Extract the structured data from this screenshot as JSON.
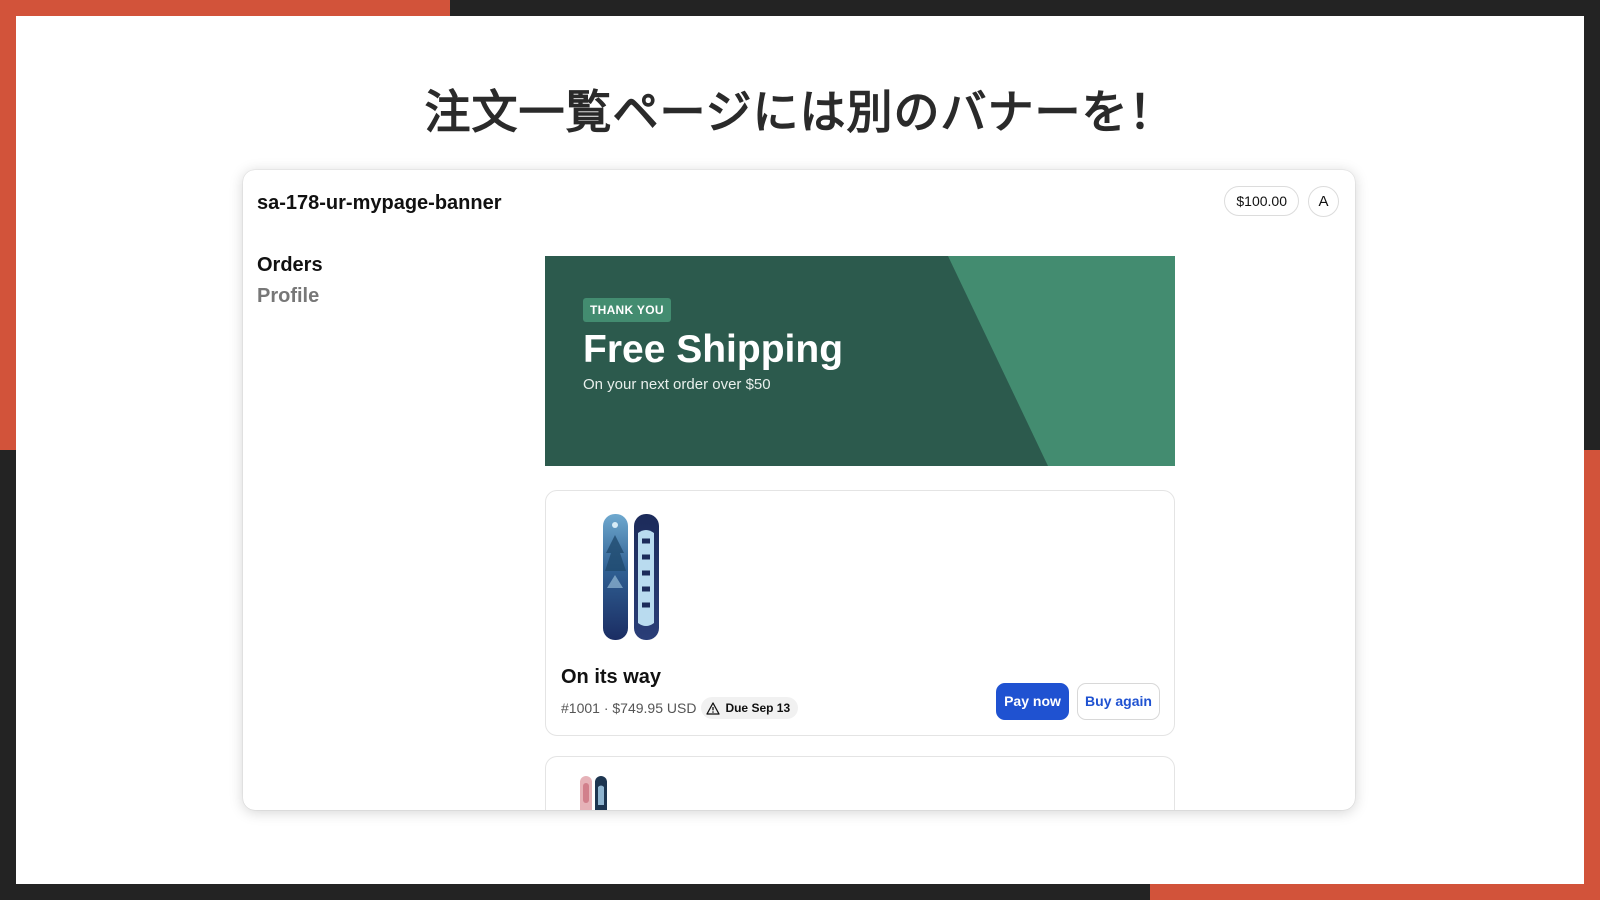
{
  "slide": {
    "title": "注文一覧ページには別のバナーを！"
  },
  "header": {
    "store_name": "sa-178-ur-mypage-banner",
    "store_credit": "$100.00",
    "avatar_initial": "A"
  },
  "sidebar": {
    "items": [
      {
        "label": "Orders",
        "active": true
      },
      {
        "label": "Profile",
        "active": false
      }
    ]
  },
  "banner": {
    "tag": "THANK YOU",
    "title": "Free Shipping",
    "subtitle": "On your next order over $50",
    "colors": {
      "background": "#2c5a4d",
      "accent": "#438c70"
    }
  },
  "orders": [
    {
      "status": "On its way",
      "number": "#1001",
      "total": "$749.95 USD",
      "meta": "#1001 · $749.95 USD",
      "due_label": "Due Sep 13",
      "due_icon": "warning-icon",
      "actions": {
        "pay_label": "Pay now",
        "buy_again_label": "Buy again"
      },
      "thumbnail": "snowboard-image"
    },
    {
      "thumbnail": "snowboard-image"
    }
  ],
  "colors": {
    "frame_accent": "#d2533a",
    "frame_dark": "#232323",
    "primary_button": "#1f52d1"
  }
}
